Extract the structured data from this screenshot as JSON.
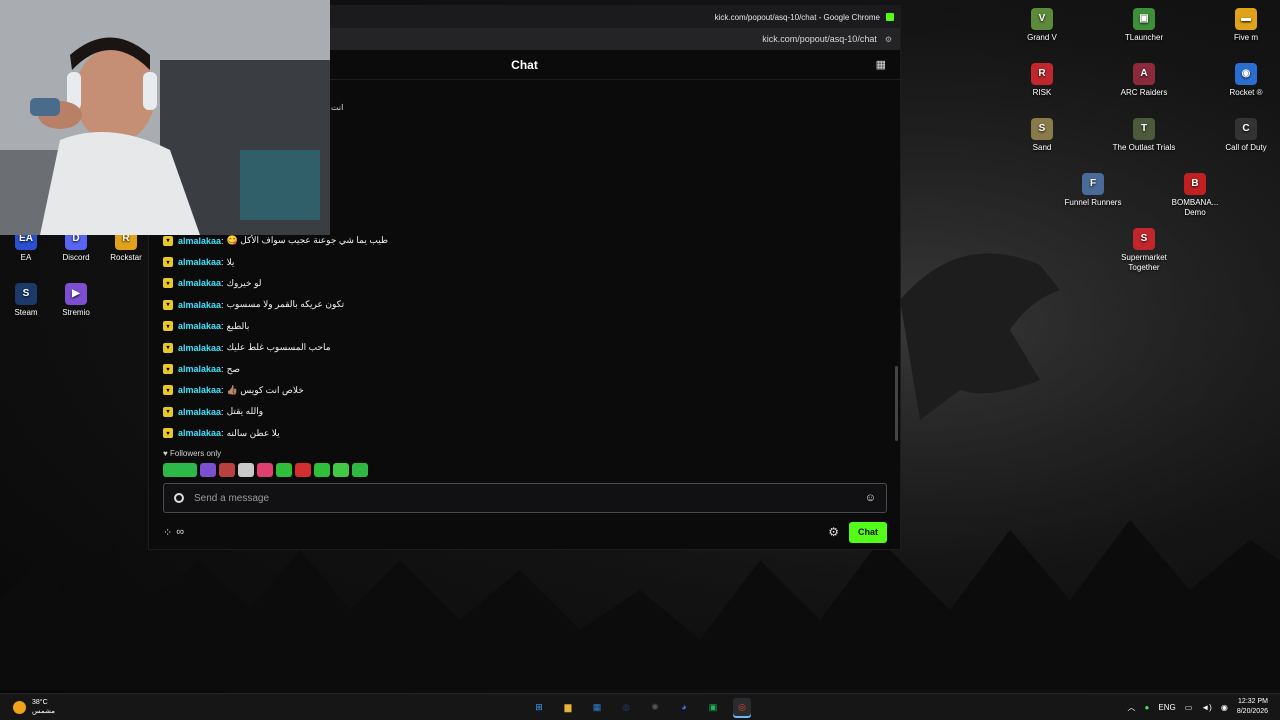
{
  "browser": {
    "window_title": "kick.com/popout/asq-10/chat - Google Chrome",
    "url": "kick.com/popout/asq-10/chat"
  },
  "chat": {
    "header_title": "Chat",
    "top_partial_text": "انت",
    "messages": [
      {
        "user": "almalakaa",
        "text": "طيب يما شي جوعنة عجيب سواف الأكل 😋"
      },
      {
        "user": "almalakaa",
        "text": "يلا"
      },
      {
        "user": "almalakaa",
        "text": "لو خيروك"
      },
      {
        "user": "almalakaa",
        "text": "تكون عريكه بالقمر ولا مسسوب"
      },
      {
        "user": "almalakaa",
        "text": "بالطبع"
      },
      {
        "user": "almalakaa",
        "text": "ماحب المسسوب غلط عليك"
      },
      {
        "user": "almalakaa",
        "text": "صح"
      },
      {
        "user": "almalakaa",
        "text": "خلاص انت كويس 👍🏽"
      },
      {
        "user": "almalakaa",
        "text": "والله يقتل"
      },
      {
        "user": "almalakaa",
        "text": "يلا عطن سالنه"
      }
    ],
    "followers_only": "Followers only",
    "emote_colors": [
      "#2db84a",
      "#7a4fd0",
      "#b84040",
      "#c8c8c8",
      "#e0406e",
      "#2fbf3a",
      "#d23030",
      "#2fbf3a",
      "#43c943",
      "#31b843"
    ],
    "input_placeholder": "Send a message",
    "infinity_symbol": "∞",
    "chat_button": "Chat"
  },
  "desktop_icons": [
    {
      "label": "Grand V",
      "color": "#5a8a3a",
      "glyph": "V"
    },
    {
      "label": "TLauncher",
      "color": "#3f8f3a",
      "glyph": "▣"
    },
    {
      "label": "Five m",
      "color": "#e0a21a",
      "glyph": "▬"
    },
    {
      "label": "RISK",
      "color": "#c0262c",
      "glyph": "R"
    },
    {
      "label": "ARC Raiders",
      "color": "#8a2a3a",
      "glyph": "A"
    },
    {
      "label": "Rocket ®",
      "color": "#2a6fd0",
      "glyph": "◉"
    },
    {
      "label": "Sand",
      "color": "#8a7a4a",
      "glyph": "S"
    },
    {
      "label": "The Outlast Trials",
      "color": "#4a5a3a",
      "glyph": "T"
    },
    {
      "label": "Call of Duty",
      "color": "#333333",
      "glyph": "C"
    },
    {
      "label": "Funnel Runners",
      "color": "#4a6a9a",
      "glyph": "F"
    },
    {
      "label": "BOMBANA... Demo",
      "color": "#c02020",
      "glyph": "B"
    },
    {
      "label": "Supermarket Together",
      "color": "#c0262c",
      "glyph": "S"
    },
    {
      "label": "EA",
      "color": "#2a4fd0",
      "glyph": "EA"
    },
    {
      "label": "Discord",
      "color": "#5865f2",
      "glyph": "D"
    },
    {
      "label": "Rockstar",
      "color": "#e0a21a",
      "glyph": "R"
    },
    {
      "label": "Steam",
      "color": "#1b3a6a",
      "glyph": "S"
    },
    {
      "label": "Stremio",
      "color": "#7b4fd0",
      "glyph": "▶"
    }
  ],
  "taskbar": {
    "temperature": "38°C",
    "weather_text": "مشمس",
    "language": "ENG",
    "time": "12:32 PM",
    "date": "8/20/2026",
    "apps": [
      {
        "name": "windows-start",
        "glyph": "⊞",
        "color": "#3aa0ff"
      },
      {
        "name": "file-explorer",
        "glyph": "▆",
        "color": "#e8b339"
      },
      {
        "name": "microsoft-store",
        "glyph": "▦",
        "color": "#2f7fd6"
      },
      {
        "name": "steam",
        "glyph": "◍",
        "color": "#1b3a6a"
      },
      {
        "name": "steelseries",
        "glyph": "✺",
        "color": "#555"
      },
      {
        "name": "discord",
        "glyph": "◕",
        "color": "#5865f2"
      },
      {
        "name": "spotify-like",
        "glyph": "▣",
        "color": "#1fb95a"
      },
      {
        "name": "chrome",
        "glyph": "◎",
        "color": "#db4437"
      }
    ]
  }
}
